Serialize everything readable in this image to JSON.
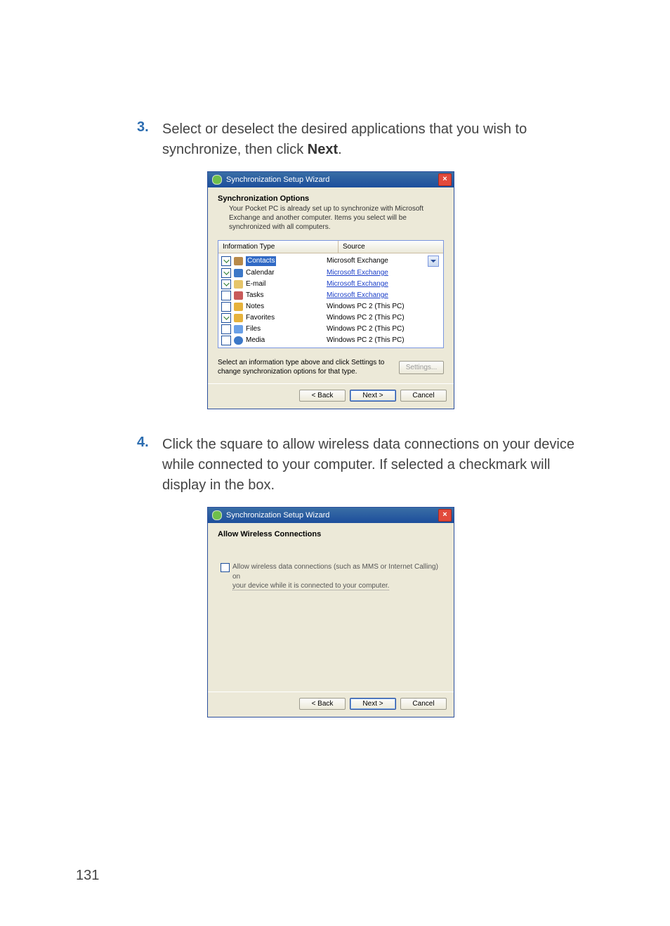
{
  "page_number": "131",
  "steps": {
    "s3": {
      "num": "3.",
      "text_a": "Select or deselect the desired applications that you wish to synchronize, then click ",
      "bold": "Next",
      "text_b": "."
    },
    "s4": {
      "num": "4.",
      "text": "Click the square to allow wireless data connections on your device while connected to your computer. If selected a checkmark will display in the box."
    }
  },
  "dlg1": {
    "title": "Synchronization Setup Wizard",
    "hdr": "Synchronization Options",
    "sub": "Your Pocket PC is already set up to synchronize with Microsoft Exchange and another computer. Items you select will be synchronized with all computers.",
    "col1": "Information Type",
    "col2": "Source",
    "rows": [
      {
        "label": "Contacts",
        "source": "Microsoft Exchange",
        "checked": true,
        "link": false,
        "icon": "ic-cn",
        "sel": true,
        "drop": true
      },
      {
        "label": "Calendar",
        "source": "Microsoft Exchange",
        "checked": true,
        "link": true,
        "icon": "ic-cl"
      },
      {
        "label": "E-mail",
        "source": "Microsoft Exchange",
        "checked": true,
        "link": true,
        "icon": "ic-em"
      },
      {
        "label": "Tasks",
        "source": "Microsoft Exchange",
        "checked": false,
        "link": true,
        "icon": "ic-tk"
      },
      {
        "label": "Notes",
        "source": "Windows PC 2 (This PC)",
        "checked": false,
        "link": false,
        "icon": "ic-nt"
      },
      {
        "label": "Favorites",
        "source": "Windows PC 2 (This PC)",
        "checked": true,
        "link": false,
        "icon": "ic-fv"
      },
      {
        "label": "Files",
        "source": "Windows PC 2 (This PC)",
        "checked": false,
        "link": false,
        "icon": "ic-fl"
      },
      {
        "label": "Media",
        "source": "Windows PC 2 (This PC)",
        "checked": false,
        "link": false,
        "icon": "ic-md"
      }
    ],
    "hint": "Select an information type above and click Settings to change synchronization options for that type.",
    "settings": "Settings...",
    "back": "< Back",
    "next": "Next >",
    "cancel": "Cancel"
  },
  "dlg2": {
    "title": "Synchronization Setup Wizard",
    "hdr": "Allow Wireless Connections",
    "opt_a": "Allow wireless data connections (such as MMS or Internet Calling) on",
    "opt_b": "your device while it is connected to your computer.",
    "back": "< Back",
    "next": "Next >",
    "cancel": "Cancel"
  }
}
